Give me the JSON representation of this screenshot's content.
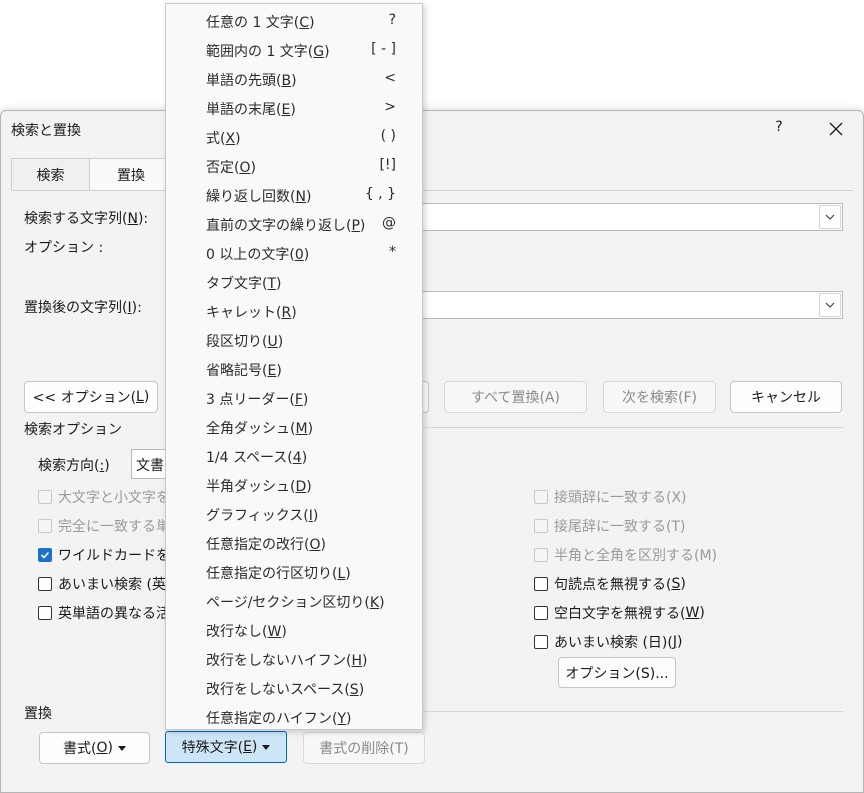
{
  "dialog": {
    "title": "検索と置換",
    "help": "?",
    "tabs": {
      "search": "検索",
      "replace": "置換"
    },
    "find": {
      "label_pre": "検索する文字列(",
      "label_key": "N",
      "label_post": "):"
    },
    "options": {
      "label": "オプション :"
    },
    "replace": {
      "label_pre": "置換後の文字列(",
      "label_key": "I",
      "label_post": "):"
    },
    "buttons": {
      "less_options_pre": "<< オプション(",
      "less_options_key": "L",
      "less_options_post": ")",
      "replace_all": "すべて置換(A)",
      "find_next": "次を検索(F)",
      "cancel": "キャンセル",
      "options_small": "オプション(S)...",
      "format_pre": "書式(",
      "format_key": "O",
      "format_post": ")",
      "special_pre": "特殊文字(",
      "special_key": "E",
      "special_post": ")",
      "clear_format": "書式の削除(T)"
    },
    "search_options": {
      "group_label": "検索オプション",
      "direction_label_pre": "検索方向(",
      "direction_label_key": ":",
      "direction_label_post": ")",
      "direction_value": "文書"
    },
    "checkboxes": {
      "match_case": "大文字と小文字を",
      "whole_word": "完全に一致する単",
      "wildcards": "ワイルドカードを使",
      "fuzzy_en": "あいまい検索 (英",
      "word_forms": "英単語の異なる活",
      "prefix": "接頭辞に一致する(X)",
      "suffix": "接尾辞に一致する(T)",
      "width": "半角と全角を区別する(M)",
      "punct_pre": "句読点を無視する(",
      "punct_key": "S",
      "punct_post": ")",
      "space_pre": "空白文字を無視する(",
      "space_key": "W",
      "space_post": ")",
      "fuzzy_jp_pre": "あいまい検索 (日)(",
      "fuzzy_jp_key": "J",
      "fuzzy_jp_post": ")"
    },
    "replace_group": {
      "label": "置換"
    }
  },
  "menu": {
    "items": [
      {
        "pre": "任意の 1 文字(",
        "key": "C",
        "post": ")",
        "shortcut": "?"
      },
      {
        "pre": "範囲内の 1 文字(",
        "key": "G",
        "post": ")",
        "shortcut": "[ - ]"
      },
      {
        "pre": "単語の先頭(",
        "key": "B",
        "post": ")",
        "shortcut": "<"
      },
      {
        "pre": "単語の末尾(",
        "key": "E",
        "post": ")",
        "shortcut": ">"
      },
      {
        "pre": "式(",
        "key": "X",
        "post": ")",
        "shortcut": "( )"
      },
      {
        "pre": "否定(",
        "key": "O",
        "post": ")",
        "shortcut": "[!]"
      },
      {
        "pre": "繰り返し回数(",
        "key": "N",
        "post": ")",
        "shortcut": "{ , }"
      },
      {
        "pre": "直前の文字の繰り返し(",
        "key": "P",
        "post": ")",
        "shortcut": "@"
      },
      {
        "pre": "0 以上の文字(",
        "key": "0",
        "post": ")",
        "shortcut": "*"
      },
      {
        "pre": "タブ文字(",
        "key": "T",
        "post": ")",
        "shortcut": ""
      },
      {
        "pre": "キャレット(",
        "key": "R",
        "post": ")",
        "shortcut": ""
      },
      {
        "pre": "段区切り(",
        "key": "U",
        "post": ")",
        "shortcut": ""
      },
      {
        "pre": "省略記号(",
        "key": "E",
        "post": ")",
        "shortcut": ""
      },
      {
        "pre": "3 点リーダー(",
        "key": "F",
        "post": ")",
        "shortcut": ""
      },
      {
        "pre": "全角ダッシュ(",
        "key": "M",
        "post": ")",
        "shortcut": ""
      },
      {
        "pre": "1/4 スペース(",
        "key": "4",
        "post": ")",
        "shortcut": ""
      },
      {
        "pre": "半角ダッシュ(",
        "key": "D",
        "post": ")",
        "shortcut": ""
      },
      {
        "pre": "グラフィックス(",
        "key": "I",
        "post": ")",
        "shortcut": ""
      },
      {
        "pre": "任意指定の改行(",
        "key": "O",
        "post": ")",
        "shortcut": ""
      },
      {
        "pre": "任意指定の行区切り(",
        "key": "L",
        "post": ")",
        "shortcut": ""
      },
      {
        "pre": "ページ/セクション区切り(",
        "key": "K",
        "post": ")",
        "shortcut": ""
      },
      {
        "pre": "改行なし(",
        "key": "W",
        "post": ")",
        "shortcut": ""
      },
      {
        "pre": "改行をしないハイフン(",
        "key": "H",
        "post": ")",
        "shortcut": ""
      },
      {
        "pre": "改行をしないスペース(",
        "key": "S",
        "post": ")",
        "shortcut": ""
      },
      {
        "pre": "任意指定のハイフン(",
        "key": "Y",
        "post": ")",
        "shortcut": ""
      }
    ]
  },
  "colors": {
    "accent": "#0067c0",
    "checkbox_checked": "#1a73c8",
    "special_button_bg": "#cde6f7"
  }
}
